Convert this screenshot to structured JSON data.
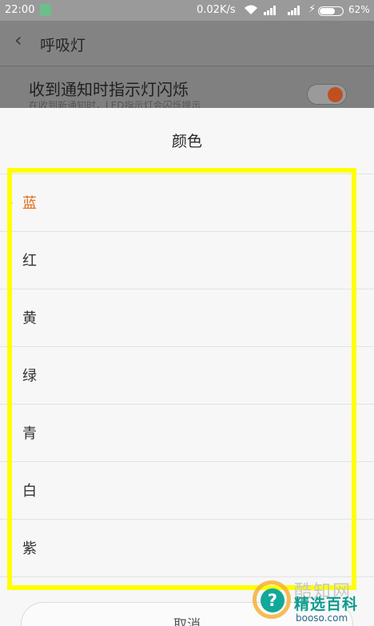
{
  "status_bar": {
    "time": "22:00",
    "network_speed": "0.02K/s",
    "battery_percent": "62%",
    "battery_level": 0.62
  },
  "nav": {
    "back_glyph": "‹",
    "title": "呼吸灯"
  },
  "setting": {
    "label": "收到通知时指示灯闪烁",
    "sub_label": "在收到新通知时，LED指示灯会闪烁提示",
    "toggle_on": true,
    "toggle_color": "#c0501f"
  },
  "dialog": {
    "title": "颜色",
    "options": [
      {
        "label": "蓝",
        "selected": true
      },
      {
        "label": "红",
        "selected": false
      },
      {
        "label": "黄",
        "selected": false
      },
      {
        "label": "绿",
        "selected": false
      },
      {
        "label": "青",
        "selected": false
      },
      {
        "label": "白",
        "selected": false
      },
      {
        "label": "紫",
        "selected": false
      }
    ],
    "cancel_label": "取消",
    "accent_color": "#e06a1b"
  },
  "annotation": {
    "highlight_color": "#ffff00"
  },
  "watermark": {
    "badge_glyph": "?",
    "blurred_text": "酷知网",
    "title": "精选百科",
    "subtitle": "booso.com"
  },
  "icons": [
    "shield-icon",
    "wifi-icon",
    "signal-icon",
    "charging-icon",
    "battery-icon",
    "back-arrow-icon",
    "selected-marker-icon",
    "help-icon"
  ]
}
